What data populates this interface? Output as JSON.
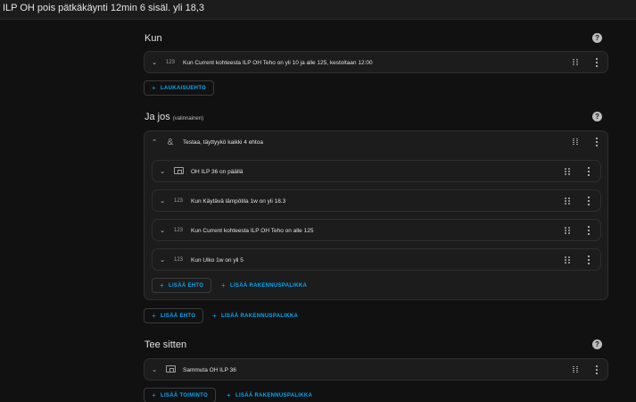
{
  "header": {
    "title": "ILP OH pois pätkäkäynti 12min 6 sisäl. yli 18,3"
  },
  "sections": {
    "triggers": {
      "title": "Kun",
      "items": [
        {
          "type_icon": "123",
          "label": "Kun Current kohteesta ILP OH Teho on yli 10 ja alle 125, kestoltaan 12:00"
        }
      ],
      "add_label": "LAUKAISUEHTO"
    },
    "conditions": {
      "title": "Ja jos",
      "optional": "(valinnainen)",
      "group": {
        "icon": "&",
        "label": "Testaa, täyttyykö kaikki 4 ehtoa",
        "items": [
          {
            "type_icon": "device",
            "label": "OH ILP 36 on päällä"
          },
          {
            "type_icon": "123",
            "label": "Kun Käytävä lämpötila 1w on yli 18.3"
          },
          {
            "type_icon": "123",
            "label": "Kun Current kohteesta ILP OH Teho on alle 125"
          },
          {
            "type_icon": "123",
            "label": "Kun Ulko 1w on yli 5"
          }
        ],
        "add_condition_label": "LISÄÄ EHTO",
        "add_block_label": "LISÄÄ RAKENNUSPALIKKA"
      },
      "add_condition_label": "LISÄÄ EHTO",
      "add_block_label": "LISÄÄ RAKENNUSPALIKKA"
    },
    "actions": {
      "title": "Tee sitten",
      "items": [
        {
          "type_icon": "device",
          "label": "Sammuta OH ILP 36"
        }
      ],
      "add_action_label": "LISÄÄ TOIMINTO",
      "add_block_label": "LISÄÄ RAKENNUSPALIKKA"
    }
  },
  "icons": {
    "help": "?",
    "plus": "+",
    "chevron_down": "⌄",
    "chevron_up": "⌃"
  },
  "colors": {
    "background": "#111111",
    "card": "#1c1c1c",
    "accent": "#03a9f4",
    "text": "#e1e1e1"
  }
}
